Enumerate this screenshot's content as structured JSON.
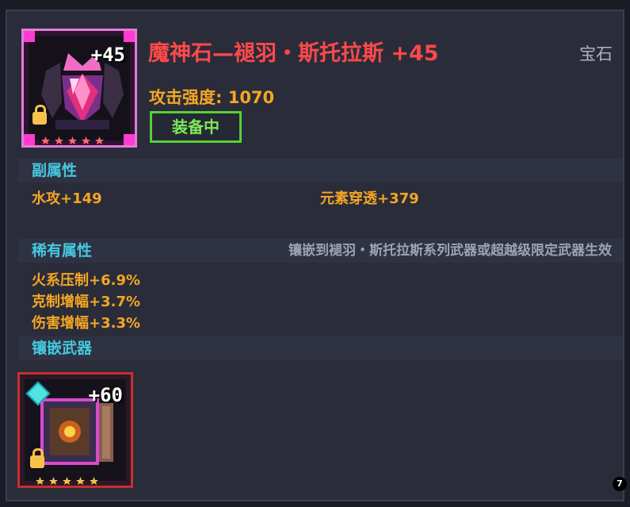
{
  "item": {
    "level_badge": "+45",
    "title": "魔神石—褪羽・斯托拉斯 +45",
    "type": "宝石",
    "attack_label": "攻击强度: 1070",
    "equipped_label": "装备中",
    "icon": "demon-gem-icon",
    "star_count": 5
  },
  "sections": {
    "secondary": {
      "label": "副属性",
      "stats": [
        "水攻+149",
        "元素穿透+379"
      ]
    },
    "rare": {
      "label": "稀有属性",
      "note": "镶嵌到褪羽・斯托拉斯系列武器或超越级限定武器生效",
      "stats": [
        "火系压制+6.9%",
        "克制增幅+3.7%",
        "伤害增幅+3.3%"
      ]
    },
    "socketed": {
      "label": "镶嵌武器",
      "weapon_level": "+60",
      "weapon_icon": "grimoire-weapon-icon",
      "star_count": 5
    }
  },
  "corner_badge": "7",
  "colors": {
    "title": "#ff4949",
    "stat": "#f5a623",
    "section_label": "#45c9df",
    "equipped": "#55d135"
  }
}
